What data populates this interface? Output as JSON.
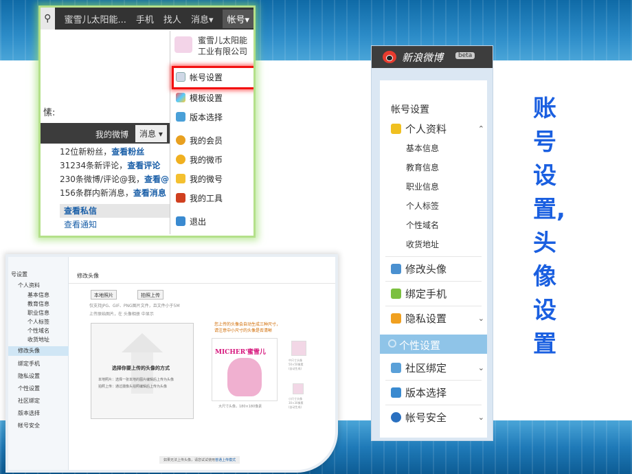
{
  "topnav": {
    "items": [
      "蜜雪儿太阳能...",
      "手机",
      "找人",
      "消息▾",
      "帐号▾"
    ]
  },
  "leftpane": {
    "colon": "愫:",
    "msgbar": {
      "tab1": "我的微博",
      "tab2": "消息 ▾"
    },
    "messages": [
      {
        "text": "12位新粉丝，",
        "link": "查看粉丝"
      },
      {
        "text": "31234条新评论，",
        "link": "查看评论"
      },
      {
        "text": "230条微博/评论@我，",
        "link": "查看@"
      },
      {
        "text": "156条群内新消息，",
        "link": "查看消息"
      }
    ],
    "private": "查看私信",
    "notice": "查看通知"
  },
  "dropdown": {
    "company": "蜜雪儿太阳能工业有限公司",
    "items": [
      "帐号设置",
      "模板设置",
      "版本选择",
      "我的会员",
      "我的微币",
      "我的微号",
      "我的工具",
      "退出"
    ],
    "highlighted": "帐号设置"
  },
  "shot2": {
    "sidebar": [
      "号设置",
      "个人资料",
      "基本信息",
      "教育信息",
      "职业信息",
      "个人标签",
      "个性域名",
      "收货地址",
      "修改头像",
      "绑定手机",
      "隐私设置",
      "个性设置",
      "社区绑定",
      "版本选择",
      "帐号安全"
    ],
    "title": "修改头像",
    "btn_local": "本地照片",
    "btn_camera": "拍照上传",
    "note1": "仅支持JPG、GIF、PNG图片文件，且文件小于5M",
    "note2": "上传原始图片，在 头像相册 中显示",
    "upload_title": "选择你要上传的头像的方式",
    "upload_line1": "本地照片：选择一张本地的图片编辑后上传为头像",
    "upload_line2": "拍照上传：通过摄像头拍照编辑后上传为头像",
    "orange1": "您上传的头像会自动生成三种尺寸，",
    "orange2": "请注意中小尺寸的头像是否清晰",
    "brand": "MICHER'蜜雪儿",
    "big_caption": "大尺寸头像，180×180像素",
    "mid_caption": [
      "中尺寸头像",
      "50×50像素",
      "(自动生成)"
    ],
    "small_caption": [
      "小尺寸头像",
      "30×30像素",
      "(自动生成)"
    ],
    "footer_text": "如果无法上传头像，请您试试使用",
    "footer_link": "普通上传模式"
  },
  "panel": {
    "brand": "新浪微博",
    "beta": "beta",
    "title": "帐号设置",
    "profile": "个人资料",
    "subitems": [
      "基本信息",
      "教育信息",
      "职业信息",
      "个人标签",
      "个性域名",
      "收货地址"
    ],
    "items": [
      "修改头像",
      "绑定手机",
      "隐私设置",
      "个性设置",
      "社区绑定",
      "版本选择",
      "帐号安全"
    ]
  },
  "side_title": [
    "账",
    "号",
    "设",
    "置,",
    "头",
    "像",
    "设",
    "置"
  ],
  "colors": {
    "accent": "#1a5fe0",
    "highlight": "#f21010",
    "selected": "#8fc4e8"
  }
}
